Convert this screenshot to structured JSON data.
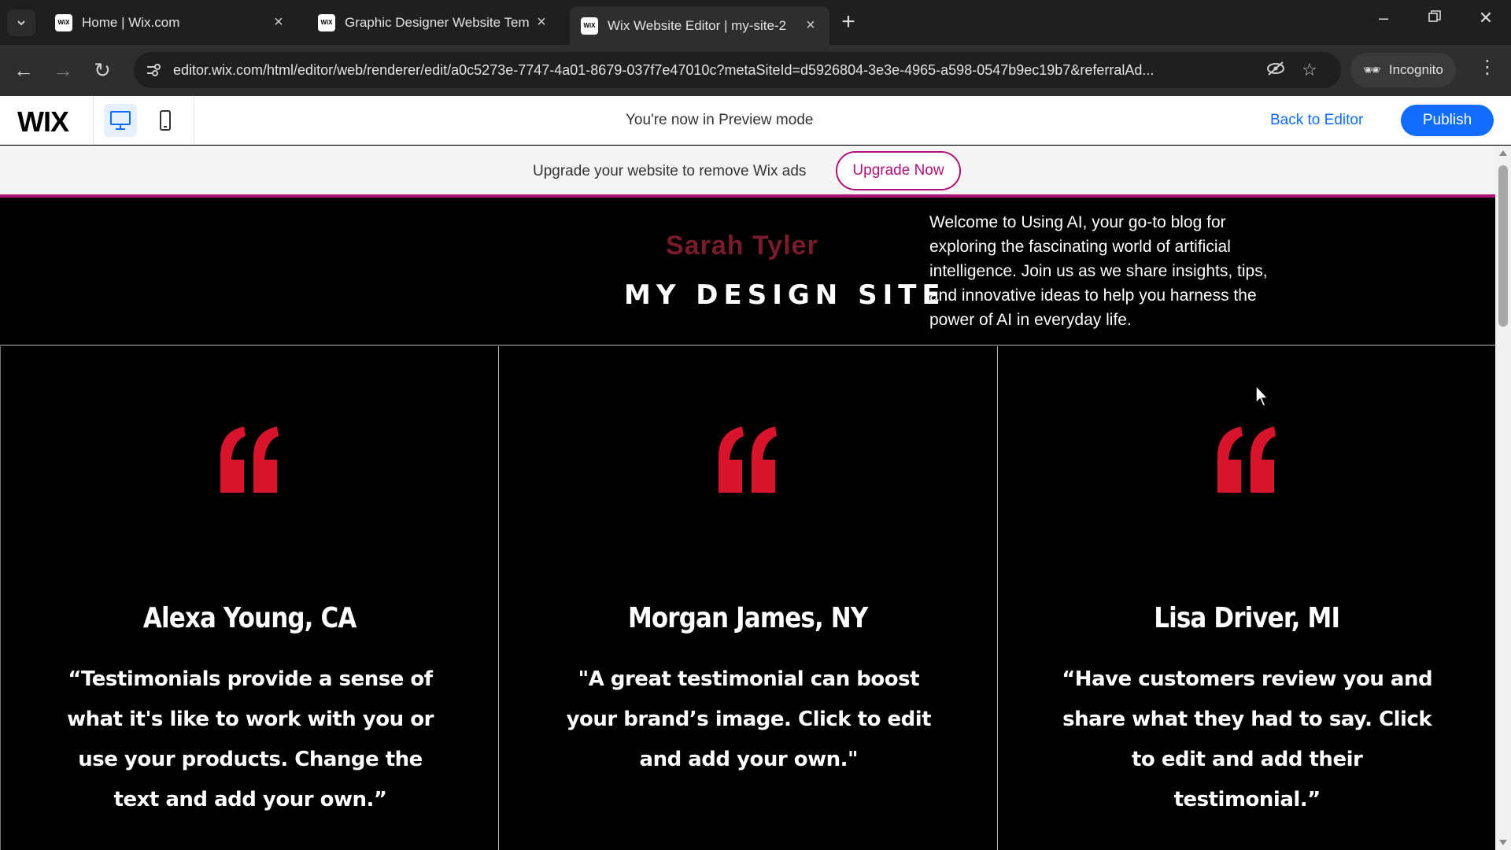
{
  "browser": {
    "tabs": [
      {
        "title": "Home | Wix.com",
        "favicon": "WiX"
      },
      {
        "title": "Graphic Designer Website Tem",
        "favicon": "WiX"
      },
      {
        "title": "Wix Website Editor | my-site-2",
        "favicon": "WiX"
      }
    ],
    "url": "editor.wix.com/html/editor/web/renderer/edit/a0c5273e-7747-4a01-8679-037f7e47010c?metaSiteId=d5926804-3e3e-4965-a598-0547b9ec19b7&referralAd...",
    "incognito_label": "Incognito"
  },
  "wixbar": {
    "logo": "WIX",
    "preview_message": "You're now in Preview mode",
    "back_to_editor": "Back to Editor",
    "publish": "Publish"
  },
  "ad_banner": {
    "text": "Upgrade your website to remove Wix ads",
    "button": "Upgrade Now"
  },
  "site": {
    "owner": "Sarah Tyler",
    "title": "MY DESIGN SITE",
    "intro": "Welcome to Using AI, your go-to blog for exploring the fascinating world of artificial intelligence. Join us as we share insights, tips, and innovative ideas to help you harness the power of AI in everyday life."
  },
  "testimonials": [
    {
      "name": "Alexa Young, CA",
      "quote": "“Testimonials provide a sense of what it's like to work with you or use your products. Change the text and add your own.”"
    },
    {
      "name": "Morgan James, NY",
      "quote": "\"A great testimonial can boost your brand’s image. Click to edit and add your own.\""
    },
    {
      "name": "Lisa Driver, MI",
      "quote": "“Have customers review you and share what they had to say. Click to edit and add their testimonial.”"
    }
  ],
  "colors": {
    "accent_red": "#d7142c",
    "wix_blue": "#116dff",
    "ad_magenta": "#b0127a",
    "owner_color": "#7a1b2b"
  }
}
